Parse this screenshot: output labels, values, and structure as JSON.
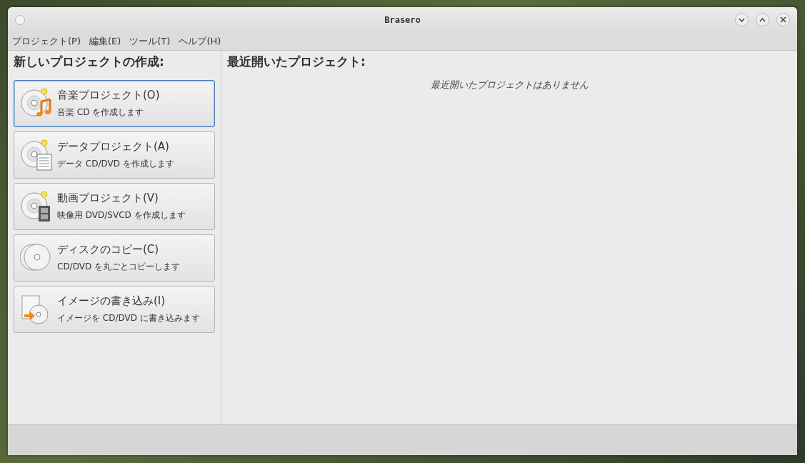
{
  "window": {
    "title": "Brasero"
  },
  "menu": [
    "プロジェクト(P)",
    "編集(E)",
    "ツール(T)",
    "ヘルプ(H)"
  ],
  "new_project": {
    "heading": "新しいプロジェクトの作成:",
    "items": [
      {
        "kind": "music",
        "title": "音楽プロジェクト(O)",
        "description": "音楽 CD を作成します",
        "selected": true
      },
      {
        "kind": "data",
        "title": "データプロジェクト(A)",
        "description": "データ CD/DVD を作成します",
        "selected": false
      },
      {
        "kind": "video",
        "title": "動画プロジェクト(V)",
        "description": "映像用 DVD/SVCD を作成します",
        "selected": false
      },
      {
        "kind": "copy",
        "title": "ディスクのコピー(C)",
        "description": "CD/DVD を丸ごとコピーします",
        "selected": false
      },
      {
        "kind": "image",
        "title": "イメージの書き込み(I)",
        "description": "イメージを CD/DVD に書き込みます",
        "selected": false
      }
    ]
  },
  "recent": {
    "heading": "最近開いたプロジェクト:",
    "empty_message": "最近開いたプロジェクトはありません"
  }
}
